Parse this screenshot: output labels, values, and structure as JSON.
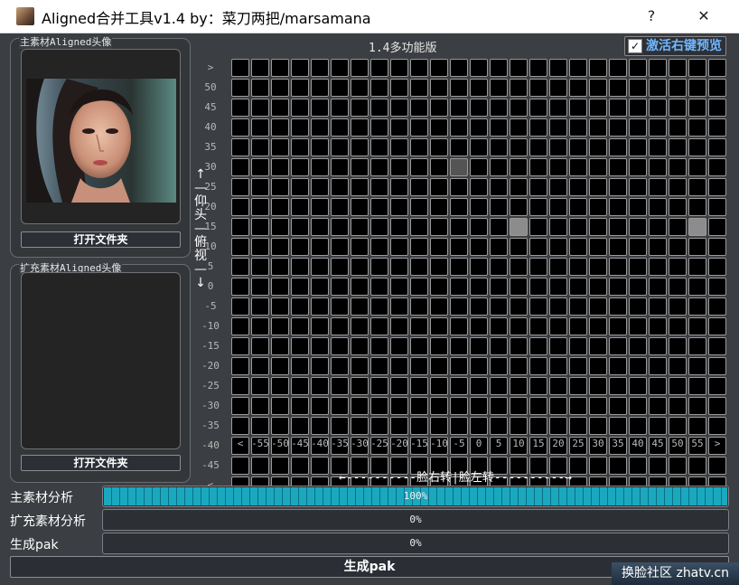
{
  "window": {
    "title": "Aligned合并工具v1.4  by：菜刀两把/marsamana",
    "help_label": "?",
    "close_label": "✕"
  },
  "main_group": {
    "title": "主素材Aligned头像",
    "open_button": "打开文件夹"
  },
  "ext_group": {
    "title": "扩充素材Aligned头像",
    "open_button": "打开文件夹"
  },
  "mode_label": "1.4多功能版",
  "preview_checkbox": {
    "label": "激活右键预览",
    "checked": true,
    "check_glyph": "✓"
  },
  "grid": {
    "y_labels": [
      ">",
      "50",
      "45",
      "40",
      "35",
      "30",
      "25",
      "20",
      "15",
      "10",
      "5",
      "0",
      "-5",
      "-10",
      "-15",
      "-20",
      "-25",
      "-30",
      "-35",
      "-40",
      "-45",
      "<"
    ],
    "x_labels": [
      "<",
      "-55",
      "-50",
      "-45",
      "-40",
      "-35",
      "-30",
      "-25",
      "-20",
      "-15",
      "-10",
      "-5",
      "0",
      "5",
      "10",
      "15",
      "20",
      "25",
      "30",
      "35",
      "40",
      "45",
      "50",
      "55",
      ">"
    ],
    "rows": [
      "0000000000000000000000000",
      "0000000000000000000000000",
      "0000000000000000000000000",
      "0000000000000000000000000",
      "0000000000000000000000000",
      "0000000000010000000000000",
      "0000000000000000000000000",
      "0000000000000000000000000",
      "0000000000000020000000020",
      "0000000000000000000000000",
      "0000000000000000000000000",
      "0000000000000000000000000",
      "0000000000000000000000000",
      "0000000000000000000000000",
      "0000000000000000000000000",
      "0000000000000000000000000",
      "0000000000000000000000000",
      "0000000000000000000000000",
      "0000000000000000000000000",
      "0000000000000000000000000",
      "0000000000000000000000000",
      "0000000000000000000000000"
    ],
    "vertical_caption": "↑—仰头—俯视—↓",
    "horizontal_caption": "←----------脸右转|脸左转----------→"
  },
  "progress": [
    {
      "label": "主素材分析",
      "value": 100,
      "text": "100%"
    },
    {
      "label": "扩充素材分析",
      "value": 0,
      "text": "0%"
    },
    {
      "label": "生成pak",
      "value": 0,
      "text": "0%"
    }
  ],
  "generate_button": "生成pak",
  "watermark": "换脸社区 zhatv.cn",
  "colors": {
    "cell_empty": "#000000",
    "cell_low": "#545454",
    "cell_mid": "#8c8c8c",
    "cell_high": "#e6e6e6",
    "progress_fill": "#1aa8bf",
    "checkbox_label": "#6fb7ff"
  }
}
